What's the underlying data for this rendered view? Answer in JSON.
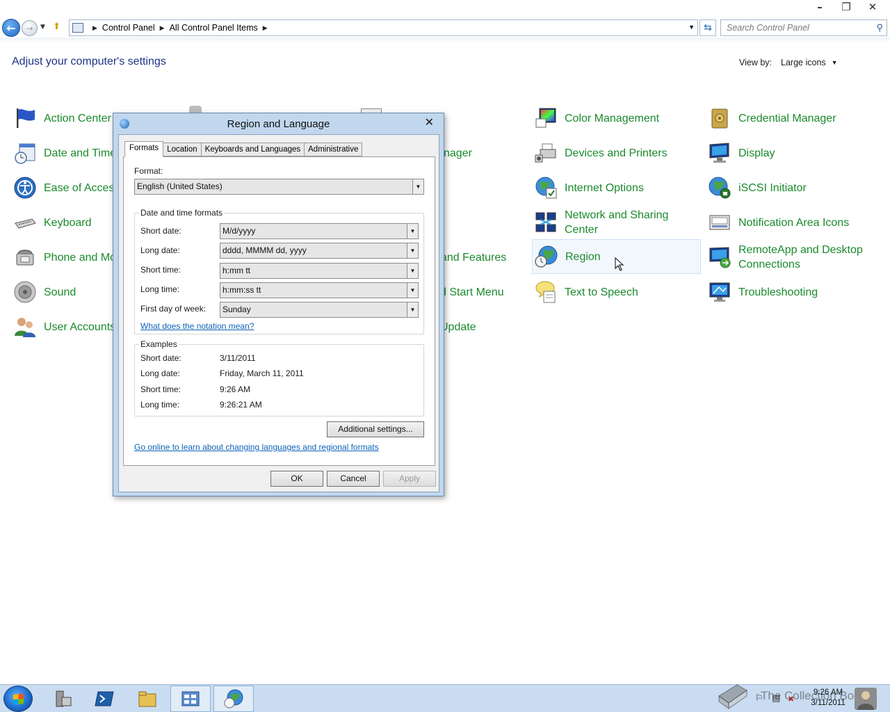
{
  "window": {
    "minimize_icon": "minimize-icon",
    "maximize_icon": "restore-icon",
    "close_icon": "close-icon"
  },
  "address_bar": {
    "breadcrumbs": [
      "Control Panel",
      "All Control Panel Items"
    ],
    "search_placeholder": "Search Control Panel"
  },
  "header": {
    "title": "Adjust your computer's settings",
    "view_by_label": "View by:",
    "view_by_value": "Large icons"
  },
  "items": [
    {
      "label": "Action Center",
      "icon": "flag-icon"
    },
    {
      "label": "Date and Time",
      "icon": "calendar-clock-icon"
    },
    {
      "label": "Ease of Access",
      "icon": "accessibility-icon"
    },
    {
      "label": "Keyboard",
      "icon": "keyboard-icon"
    },
    {
      "label": "Phone and Mo",
      "icon": "phone-modem-icon"
    },
    {
      "label": "Sound",
      "icon": "speaker-icon"
    },
    {
      "label": "User Accounts",
      "icon": "users-icon"
    },
    {
      "label": "nager"
    },
    {
      "label": "and Features"
    },
    {
      "label": "d Start Menu"
    },
    {
      "label": "Update"
    },
    {
      "label": "Color Management",
      "icon": "color-management-icon"
    },
    {
      "label": "Devices and Printers",
      "icon": "printer-icon"
    },
    {
      "label": "Internet Options",
      "icon": "globe-check-icon"
    },
    {
      "label": "Network and Sharing\nCenter",
      "label_line1": "Network and Sharing",
      "label_line2": "Center",
      "icon": "network-icon"
    },
    {
      "label": "Region",
      "icon": "region-globe-icon"
    },
    {
      "label": "Text to Speech",
      "icon": "speech-bubble-icon"
    },
    {
      "label": "Credential Manager",
      "icon": "vault-icon"
    },
    {
      "label": "Display",
      "icon": "monitor-icon"
    },
    {
      "label": "iSCSI Initiator",
      "icon": "iscsi-globe-icon"
    },
    {
      "label": "Notification Area Icons",
      "icon": "notification-area-icon"
    },
    {
      "label_line1": "RemoteApp and Desktop",
      "label_line2": "Connections",
      "icon": "remote-desktop-icon"
    },
    {
      "label": "Troubleshooting",
      "icon": "troubleshoot-monitor-icon"
    }
  ],
  "dialog": {
    "title": "Region and Language",
    "tabs": [
      "Formats",
      "Location",
      "Keyboards and Languages",
      "Administrative"
    ],
    "format_label": "Format:",
    "format_value": "English (United States)",
    "dt_group_title": "Date and time formats",
    "fields": [
      {
        "label": "Short date:",
        "value": "M/d/yyyy"
      },
      {
        "label": "Long date:",
        "value": "dddd, MMMM dd, yyyy"
      },
      {
        "label": "Short time:",
        "value": "h:mm tt"
      },
      {
        "label": "Long time:",
        "value": "h:mm:ss tt"
      },
      {
        "label": "First day of week:",
        "value": "Sunday"
      }
    ],
    "notation_link": "What does the notation mean?",
    "examples_title": "Examples",
    "examples": [
      {
        "label": "Short date:",
        "value": "3/11/2011"
      },
      {
        "label": "Long date:",
        "value": "Friday, March 11, 2011"
      },
      {
        "label": "Short time:",
        "value": "9:26 AM"
      },
      {
        "label": "Long time:",
        "value": "9:26:21 AM"
      }
    ],
    "additional_settings": "Additional settings...",
    "online_link": "Go online to learn about changing languages and regional formats",
    "ok": "OK",
    "cancel": "Cancel",
    "apply": "Apply"
  },
  "taskbar": {
    "time": "9:26 AM",
    "date": "3/11/2011",
    "watermark": "The Collection Book"
  }
}
